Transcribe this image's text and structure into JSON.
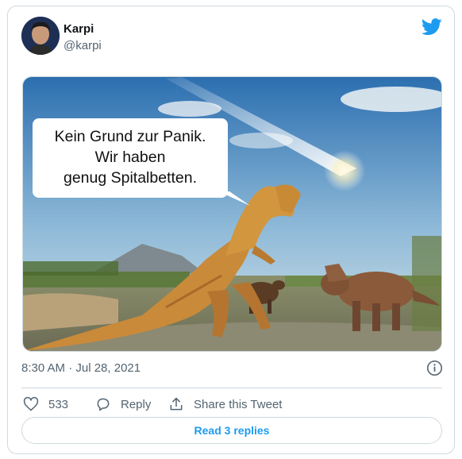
{
  "user": {
    "name": "Karpi",
    "handle": "@karpi"
  },
  "meme": {
    "lines": [
      "Kein Grund zur Panik.",
      "Wir haben",
      "genug Spitalbetten."
    ]
  },
  "tweet": {
    "timestamp": "8:30 AM · Jul 28, 2021"
  },
  "actions": {
    "likes": "533",
    "reply_label": "Reply",
    "share_label": "Share this Tweet"
  },
  "read_replies": "Read 3 replies",
  "colors": {
    "accent": "#1d9bf0",
    "muted": "#536471",
    "border": "#cfd9de"
  }
}
